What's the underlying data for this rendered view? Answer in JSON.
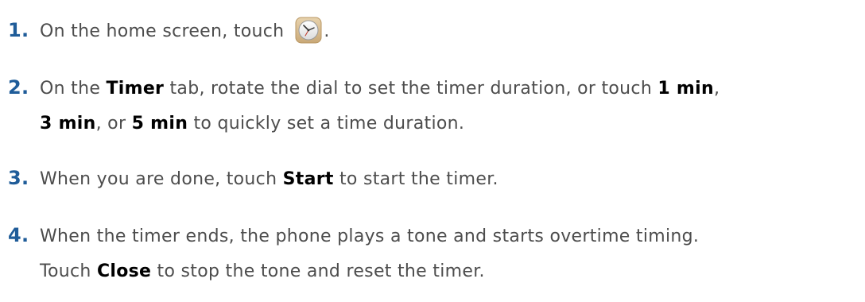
{
  "steps": [
    {
      "number": "1.",
      "parts": {
        "a": "On the home screen, touch",
        "b": "."
      },
      "icon": "clock-app-icon"
    },
    {
      "number": "2.",
      "parts": {
        "a": "On the ",
        "b": "Timer",
        "c": " tab, rotate the dial to set the timer duration, or touch ",
        "d": "1 min",
        "e": ",",
        "f": "3 min",
        "g": ", or ",
        "h": "5 min",
        "i": " to quickly set a time duration."
      }
    },
    {
      "number": "3.",
      "parts": {
        "a": "When you are done, touch ",
        "b": "Start",
        "c": " to start the timer."
      }
    },
    {
      "number": "4.",
      "parts": {
        "a": "When the timer ends, the phone plays a tone and starts overtime timing.",
        "b": "Touch ",
        "c": "Close",
        "d": " to stop the tone and reset the timer."
      }
    }
  ]
}
